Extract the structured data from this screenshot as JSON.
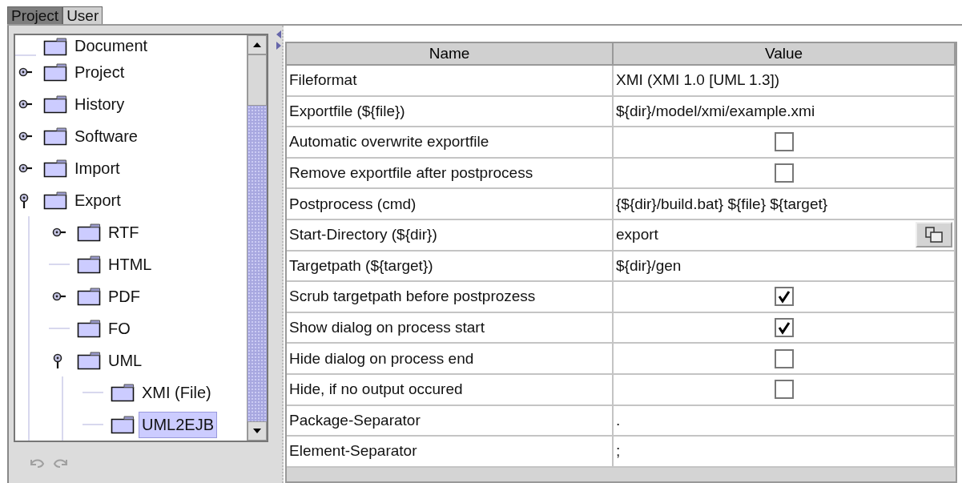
{
  "tabs": [
    {
      "label": "Project",
      "selected": false
    },
    {
      "label": "User",
      "selected": true
    }
  ],
  "tree": [
    {
      "label": "Document",
      "selected": false
    },
    {
      "label": "Project",
      "expanded": false,
      "selected": false
    },
    {
      "label": "History",
      "expanded": false,
      "selected": false
    },
    {
      "label": "Software",
      "expanded": false,
      "selected": false
    },
    {
      "label": "Import",
      "expanded": false,
      "selected": false
    },
    {
      "label": "Export",
      "expanded": true,
      "selected": false,
      "children": [
        {
          "label": "RTF",
          "expanded": false,
          "selected": false
        },
        {
          "label": "HTML",
          "selected": false
        },
        {
          "label": "PDF",
          "expanded": false,
          "selected": false
        },
        {
          "label": "FO",
          "selected": false
        },
        {
          "label": "UML",
          "expanded": true,
          "selected": false,
          "children": [
            {
              "label": "XMI (File)",
              "selected": false
            },
            {
              "label": "UML2EJB",
              "selected": true
            }
          ]
        }
      ]
    }
  ],
  "table": {
    "columns": [
      "Name",
      "Value"
    ],
    "rows": [
      {
        "name": "Fileformat",
        "kind": "text",
        "value": "XMI (XMI 1.0 [UML 1.3])"
      },
      {
        "name": "Exportfile (${file})",
        "kind": "text",
        "value": "${dir}/model/xmi/example.xmi"
      },
      {
        "name": "Automatic overwrite exportfile",
        "kind": "checkbox",
        "checked": false
      },
      {
        "name": "Remove exportfile after postprocess",
        "kind": "checkbox",
        "checked": false
      },
      {
        "name": "Postprocess (cmd)",
        "kind": "text",
        "value": "{${dir}/build.bat} ${file} ${target}"
      },
      {
        "name": "Start-Directory (${dir})",
        "kind": "directory",
        "value": "export"
      },
      {
        "name": "Targetpath (${target})",
        "kind": "text",
        "value": "${dir}/gen"
      },
      {
        "name": "Scrub targetpath before postprozess",
        "kind": "checkbox",
        "checked": true
      },
      {
        "name": "Show dialog on process start",
        "kind": "checkbox",
        "checked": true
      },
      {
        "name": "Hide dialog on process end",
        "kind": "checkbox",
        "checked": false
      },
      {
        "name": "Hide, if no output occured",
        "kind": "checkbox",
        "checked": false
      },
      {
        "name": "Package-Separator",
        "kind": "text",
        "value": "."
      },
      {
        "name": "Element-Separator",
        "kind": "text",
        "value": ";"
      }
    ]
  }
}
